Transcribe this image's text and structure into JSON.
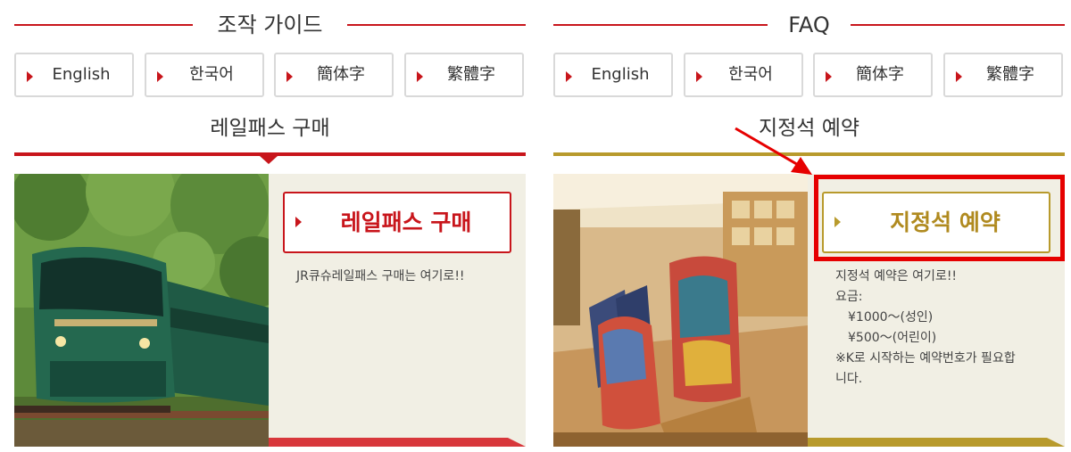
{
  "left": {
    "heading": "조작 가이드",
    "languages": [
      "English",
      "한국어",
      "簡体字",
      "繁體字"
    ],
    "section_title": "레일패스 구매",
    "cta_label": "레일패스 구매",
    "description": "JR큐슈레일패스 구매는 여기로!!",
    "accent_color": "#c8151b"
  },
  "right": {
    "heading": "FAQ",
    "languages": [
      "English",
      "한국어",
      "簡体字",
      "繁體字"
    ],
    "section_title": "지정석 예약",
    "cta_label": "지정석 예약",
    "description_lines": [
      "지정석 예약은 여기로!!",
      "요금:",
      "　¥1000～(성인)",
      "　¥500～(어린이)",
      "※K로 시작하는 예약번호가 필요합",
      "니다."
    ],
    "accent_color": "#b89a2c",
    "highlight_color": "#e60000"
  },
  "icons": {
    "arrow": "red-arrow-icon",
    "bullet": "triangle-right-icon"
  }
}
